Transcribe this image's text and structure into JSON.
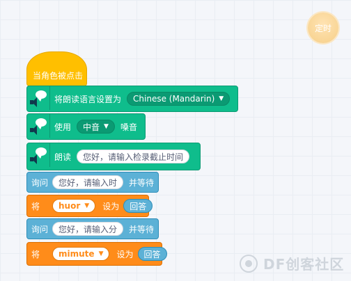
{
  "timer": {
    "label": "定时"
  },
  "hat": {
    "label": "当角色被点击"
  },
  "blocks": {
    "set_language": {
      "label": "将朗读语言设置为",
      "value": "Chinese (Mandarin)"
    },
    "use_voice": {
      "label_before": "使用",
      "value": "中音",
      "label_after": "嗓音"
    },
    "speak": {
      "label": "朗读",
      "text": "您好，请输入检录截止时间"
    },
    "ask_hour": {
      "label": "询问",
      "text": "您好，请输入时",
      "suffix": "并等待"
    },
    "set_hour": {
      "label": "将",
      "variable": "huor",
      "mid": "设为",
      "reporter": "回答"
    },
    "ask_minute": {
      "label": "询问",
      "text": "您好，请输入分",
      "suffix": "并等待"
    },
    "set_minute": {
      "label": "将",
      "variable": "mimute",
      "mid": "设为",
      "reporter": "回答"
    }
  },
  "icons": {
    "dropdown_arrow": "▼",
    "tts": "speech-bubble-speaker-icon"
  },
  "watermark": {
    "text": "DF创客社区"
  },
  "colors": {
    "event": "#ffbf00",
    "tts": "#0fbd8c",
    "sensing": "#5cb1d6",
    "data": "#ff8c1a"
  }
}
